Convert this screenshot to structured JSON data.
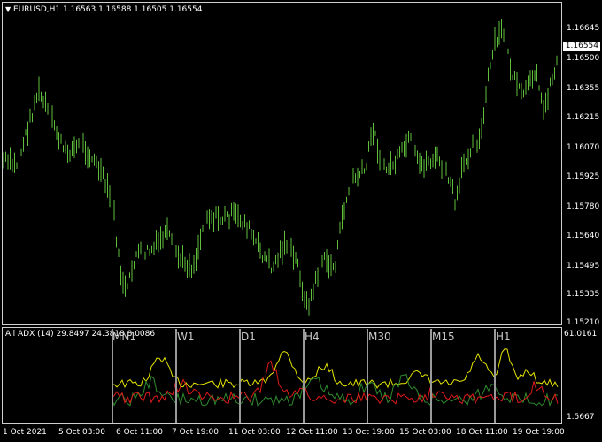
{
  "header": {
    "symbol_line": "EURUSD,H1  1.16563 1.16588 1.16505 1.16554",
    "triangle": "▼"
  },
  "price_axis": {
    "labels": [
      "1.16645",
      "1.16500",
      "1.16355",
      "1.16215",
      "1.16070",
      "1.15925",
      "1.15780",
      "1.15640",
      "1.15495",
      "1.15335",
      "1.15210"
    ],
    "current_price": "1.16554"
  },
  "indicator": {
    "title": "All ADX (14) 29.8497 24.3818 8.0086",
    "scale_max": "61.0161",
    "scale_min": "1.5667",
    "timeframes": [
      "MN1",
      "W1",
      "D1",
      "H4",
      "M30",
      "M15",
      "H1"
    ]
  },
  "time_axis": {
    "labels": [
      "1 Oct 2021",
      "5 Oct 03:00",
      "6 Oct 11:00",
      "7 Oct 19:00",
      "11 Oct 03:00",
      "12 Oct 11:00",
      "13 Oct 19:00",
      "15 Oct 03:00",
      "18 Oct 11:00",
      "19 Oct 19:00"
    ]
  },
  "colors": {
    "candles": "#5fbf3a",
    "adx_main": "#e6e600",
    "plus_di": "#2e8b2e",
    "minus_di": "#e01a1a"
  }
}
